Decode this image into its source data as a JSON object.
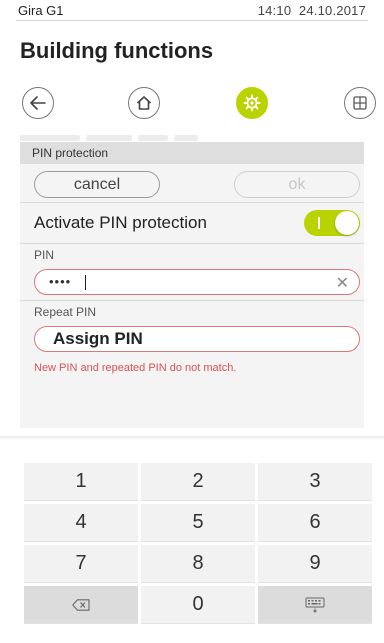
{
  "status": {
    "device": "Gira G1",
    "time": "14:10",
    "date": "24.10.2017"
  },
  "page": {
    "title": "Building functions"
  },
  "nav": {
    "icons": [
      "back-arrow-icon",
      "home-icon",
      "settings-gear-icon",
      "grid-view-icon"
    ],
    "active": "settings-gear-icon",
    "accent_color": "#b9d300"
  },
  "dialog": {
    "header": "PIN protection",
    "cancel_label": "cancel",
    "ok_label": "ok",
    "toggle_label": "Activate PIN protection",
    "toggle_on": true,
    "pin_label": "PIN",
    "pin_value": "••••",
    "repeat_label": "Repeat PIN",
    "repeat_value": "Assign PIN",
    "error": "New PIN and repeated PIN do not match.",
    "error_color": "#d9534f"
  },
  "keypad": {
    "rows": [
      [
        "1",
        "2",
        "3"
      ],
      [
        "4",
        "5",
        "6"
      ],
      [
        "7",
        "8",
        "9"
      ]
    ],
    "zero": "0",
    "backspace_icon": "backspace-icon",
    "hide_keyboard_icon": "hide-keyboard-icon"
  }
}
